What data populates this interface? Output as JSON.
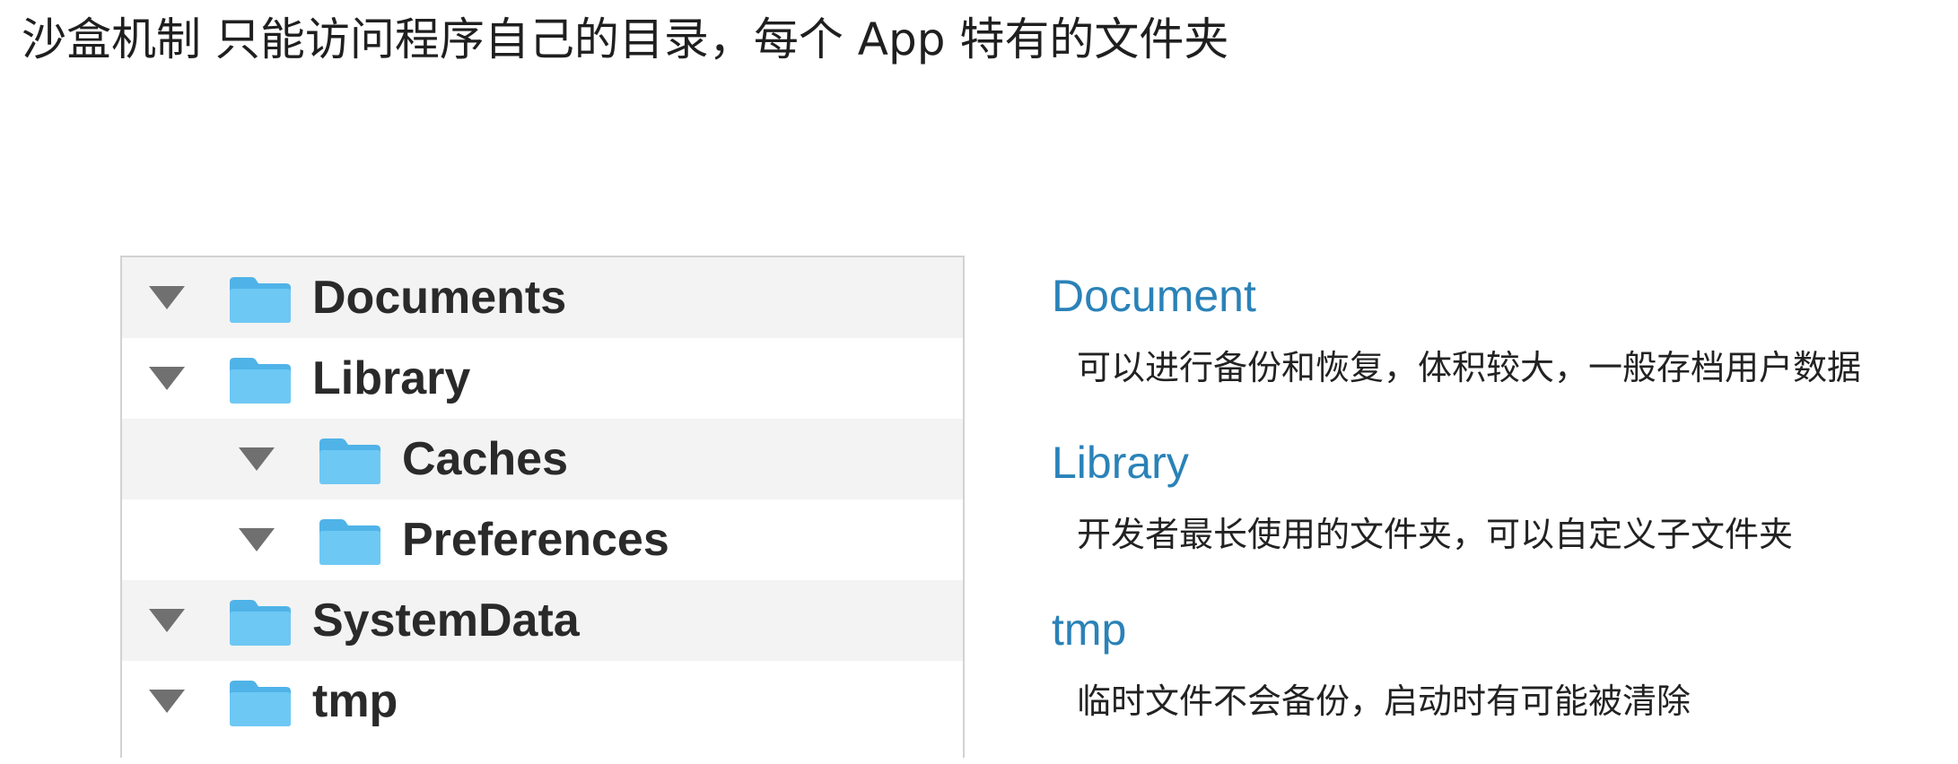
{
  "slide": {
    "title": "沙盒机制 只能访问程序自己的目录，每个 App 特有的文件夹"
  },
  "tree": {
    "rows": [
      {
        "label": "Documents",
        "level": 0,
        "icon": "folder-icon",
        "expanded": true
      },
      {
        "label": "Library",
        "level": 0,
        "icon": "folder-icon",
        "expanded": true
      },
      {
        "label": "Caches",
        "level": 1,
        "icon": "folder-icon",
        "expanded": true
      },
      {
        "label": "Preferences",
        "level": 1,
        "icon": "folder-icon",
        "expanded": true
      },
      {
        "label": "SystemData",
        "level": 0,
        "icon": "folder-icon",
        "expanded": true
      },
      {
        "label": "tmp",
        "level": 0,
        "icon": "folder-icon",
        "expanded": true
      }
    ]
  },
  "descriptions": [
    {
      "heading": "Document",
      "text": "可以进行备份和恢复，体积较大，一般存档用户数据"
    },
    {
      "heading": "Library",
      "text": "开发者最长使用的文件夹，可以自定义子文件夹"
    },
    {
      "heading": "tmp",
      "text": "临时文件不会备份，启动时有可能被清除"
    }
  ],
  "colors": {
    "heading_blue": "#2a82b8",
    "folder_blue": "#62c2f2",
    "disclosure_gray": "#707070",
    "row_shade": "#f3f3f3"
  }
}
